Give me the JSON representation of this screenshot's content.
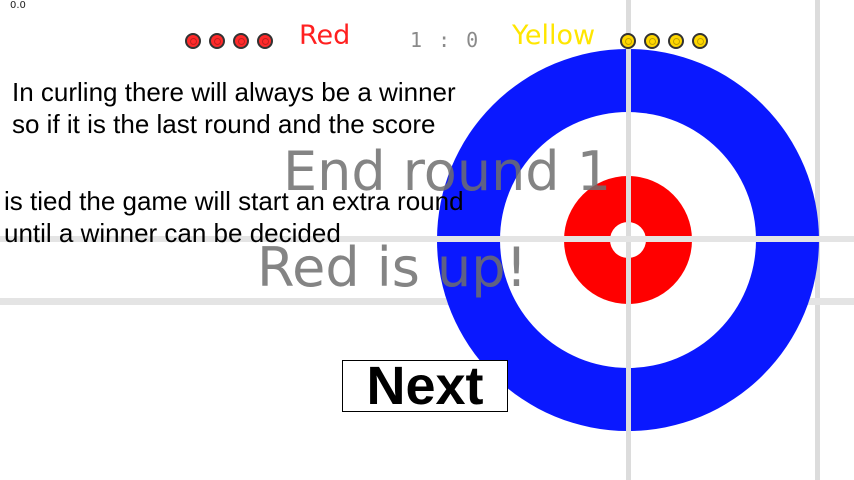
{
  "debug": {
    "fps_readout": "0.0"
  },
  "scoreboard": {
    "red": {
      "name": "Red",
      "color": "#ff2020",
      "stones_remaining": 4
    },
    "yellow": {
      "name": "Yellow",
      "color": "#ffe600",
      "stones_remaining": 4
    },
    "score": "1 : 0"
  },
  "info": {
    "line1": "In curling there will always be a winner",
    "line2": "so if it is the last round and the score",
    "line3": "is tied the game will start an extra round",
    "line4": "until a winner can be decided"
  },
  "overlay": {
    "round_message": "End round 1",
    "turn_message": "Red is up!"
  },
  "next_button": {
    "label": "Next"
  },
  "house": {
    "outer_ring_color": "#0a18ff",
    "inner_ring_color": "#ff0000",
    "background_color": "#ffffff"
  }
}
